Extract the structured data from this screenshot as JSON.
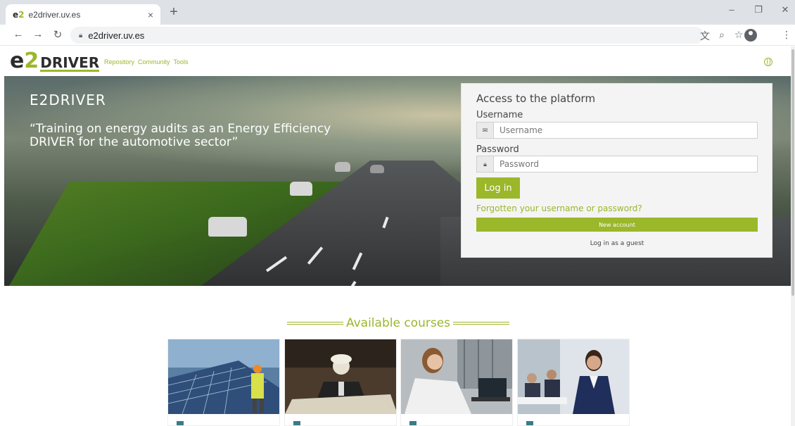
{
  "browser": {
    "tab_title": "e2driver.uv.es",
    "favicon_e": "e",
    "favicon_2": "2",
    "tab_close_glyph": "×",
    "newtab_glyph": "+",
    "url": "e2driver.uv.es"
  },
  "site": {
    "logo_e": "e",
    "logo_2": "2",
    "logo_driver": "DRIVER",
    "nav": [
      "Repository",
      "Community",
      "Tools"
    ]
  },
  "hero": {
    "title": "E2DRIVER",
    "quote": "“Training on energy audits as an Energy Efficiency DRIVER for the automotive sector”"
  },
  "login": {
    "title": "Access to the platform",
    "username_label": "Username",
    "username_placeholder": "Username",
    "password_label": "Password",
    "password_placeholder": "Password",
    "login_button": "Log in",
    "forgot_link": "Forgotten your username or password?",
    "new_account_button": "New account",
    "guest_button": "Log in as a guest"
  },
  "courses": {
    "heading": "Available courses",
    "cards": [
      {
        "name": "course-card-solar"
      },
      {
        "name": "course-card-engineer"
      },
      {
        "name": "course-card-lab"
      },
      {
        "name": "course-card-business"
      }
    ]
  },
  "colors": {
    "accent": "#9bb72a",
    "text": "#444444"
  }
}
